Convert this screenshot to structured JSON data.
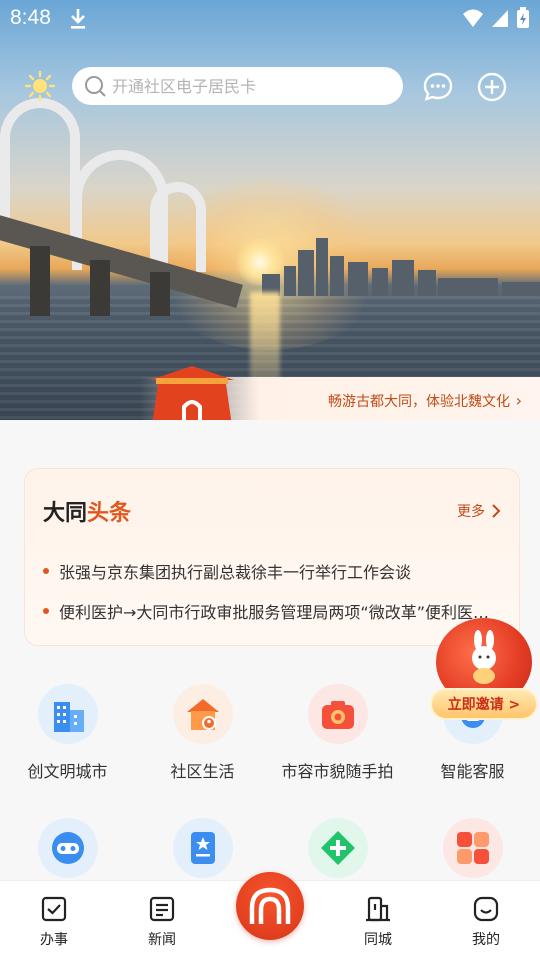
{
  "status_bar": {
    "time": "8:48"
  },
  "search": {
    "placeholder": "开通社区电子居民卡"
  },
  "banner": {
    "text": "畅游古都大同，体验北魏文化"
  },
  "news": {
    "title_main": "大同",
    "title_accent": "头条",
    "more_label": "更多",
    "items": [
      "张强与京东集团执行副总裁徐丰一行举行工作会谈",
      "便利医护→大同市行政审批服务管理局两项“微改革”便利医…"
    ]
  },
  "invite": {
    "label": "立即邀请 >"
  },
  "services_row1": [
    {
      "label": "创文明城市",
      "icon": "buildings-icon"
    },
    {
      "label": "社区生活",
      "icon": "community-home-icon"
    },
    {
      "label": "市容市貌随手拍",
      "icon": "camera-icon"
    },
    {
      "label": "智能客服",
      "icon": "robot-service-icon"
    }
  ],
  "services_row2": [
    {
      "icon": "vr-goggles-icon"
    },
    {
      "icon": "star-document-icon"
    },
    {
      "icon": "medical-plus-icon"
    },
    {
      "icon": "apps-grid-icon"
    }
  ],
  "tabbar": {
    "tabs": [
      {
        "label": "办事",
        "icon": "task-check-icon"
      },
      {
        "label": "新闻",
        "icon": "news-icon"
      },
      {
        "label": "同城",
        "icon": "city-building-icon"
      },
      {
        "label": "我的",
        "icon": "profile-smile-icon"
      }
    ],
    "center_icon": "home-arch-icon"
  },
  "colors": {
    "accent": "#e1581f",
    "brand_red": "#e23f1f"
  }
}
